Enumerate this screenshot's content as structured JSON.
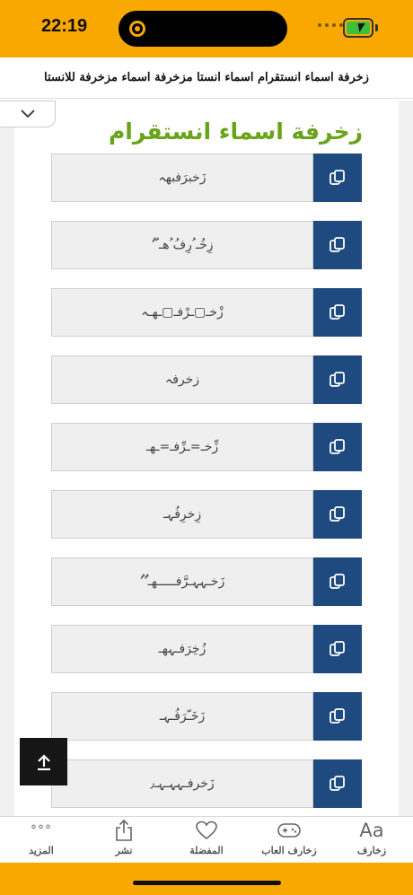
{
  "status": {
    "time": "22:19",
    "colors": {
      "bar": "#f8a800",
      "battery_fill": "#3cc03c"
    }
  },
  "header": {
    "title": "زخرفة اسماء انستقرام اسماء انستا مزخرفة اسماء مزخرفة للانستا"
  },
  "page": {
    "heading": "زخرفة اسماء انستقرام",
    "heading_color": "#68a31a"
  },
  "decorations": [
    {
      "text": "زَخبرَفبهہ"
    },
    {
      "text": "زِخُـ ُرِفُ ُهـ ُ٬ُ"
    },
    {
      "text": "زْخـ▢ـرْفـ▢ـهـہ"
    },
    {
      "text": "زخرفہ"
    },
    {
      "text": "زِّخـ=ـرِّفـ=ـهـ"
    },
    {
      "text": "زِخرِفُہـ"
    },
    {
      "text": "زَخـہہـرَّفـــــهـ٬ُ٬ُ"
    },
    {
      "text": "زُخِرَفـہهـ"
    },
    {
      "text": "زَخَـّرَفُـہـ"
    },
    {
      "text": "زَخرفـہہـہـ٫"
    }
  ],
  "ui": {
    "copy_button_color": "#1e4a80",
    "copy_icon": "copy-icon",
    "scroll_top_icon": "arrow-up-icon",
    "collapse_icon": "chevron-down-icon"
  },
  "tabs": [
    {
      "label": "زخارف",
      "icon": "font-icon",
      "glyph": "Aa"
    },
    {
      "label": "زخارف العاب",
      "icon": "gamepad-icon"
    },
    {
      "label": "المفضلة",
      "icon": "heart-icon"
    },
    {
      "label": "نشر",
      "icon": "share-icon"
    },
    {
      "label": "المزيد",
      "icon": "more-icon",
      "glyph": "°°°"
    }
  ]
}
